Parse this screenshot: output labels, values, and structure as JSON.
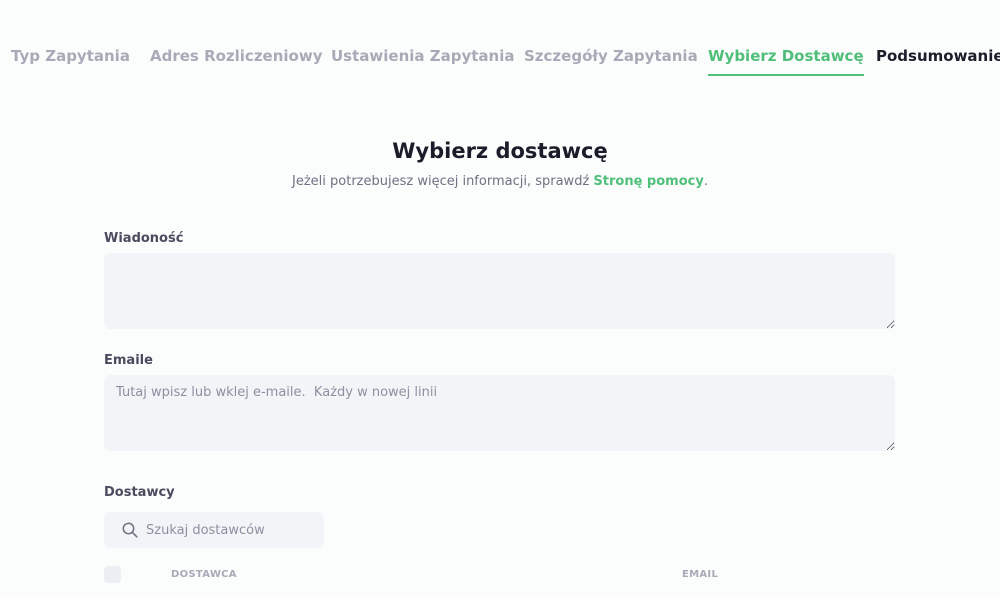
{
  "tabs": [
    {
      "label": "Typ Zapytania",
      "state": "done"
    },
    {
      "label": "Adres Rozliczeniowy",
      "state": "done"
    },
    {
      "label": "Ustawienia Zapytania",
      "state": "done"
    },
    {
      "label": "Szczegóły Zapytania",
      "state": "done"
    },
    {
      "label": "Wybierz Dostawcę",
      "state": "active"
    },
    {
      "label": "Podsumowanie",
      "state": "next"
    }
  ],
  "main": {
    "title": "Wybierz dostawcę",
    "subtitle_prefix": "Jeżeli potrzebujesz więcej informacji, sprawdź ",
    "help_link": "Stronę pomocy",
    "subtitle_suffix": "."
  },
  "form": {
    "message_label": "Wiadoność",
    "message_value": "",
    "emails_label": "Emaile",
    "emails_placeholder": "Tutaj wpisz lub wklej e-maile.  Każdy w nowej linii",
    "suppliers_label": "Dostawcy",
    "search_placeholder": "Szukaj dostawców"
  },
  "table": {
    "columns": [
      "DOSTAWCA",
      "EMAIL"
    ]
  },
  "colors": {
    "accent": "#4fbf7a",
    "inactive_tab": "#a9aab7",
    "field_bg": "#f3f4f8"
  },
  "icons": {
    "search": "search-icon"
  }
}
